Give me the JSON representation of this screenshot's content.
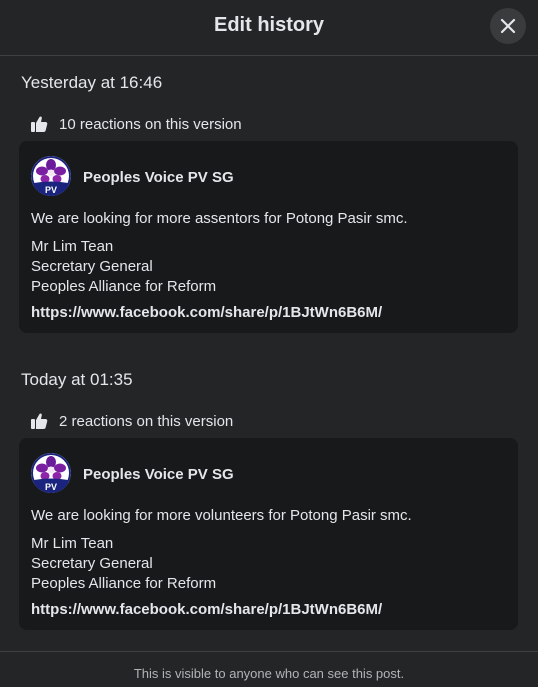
{
  "dialog": {
    "title": "Edit history",
    "close_icon": "close-icon"
  },
  "versions": [
    {
      "timestamp": "Yesterday at 16:46",
      "reactions": "10 reactions on this version",
      "post": {
        "page_name": "Peoples Voice PV SG",
        "avatar_text": "PV",
        "text": "We are looking for more assentors for Potong Pasir smc.",
        "signature": [
          "Mr Lim Tean",
          "Secretary General",
          "Peoples Alliance for Reform"
        ],
        "link": "https://www.facebook.com/share/p/1BJtWn6B6M/"
      }
    },
    {
      "timestamp": "Today at 01:35",
      "reactions": "2 reactions on this version",
      "post": {
        "page_name": "Peoples Voice PV SG",
        "avatar_text": "PV",
        "text": "We are looking for more volunteers for Potong Pasir smc.",
        "signature": [
          "Mr Lim Tean",
          "Secretary General",
          "Peoples Alliance for Reform"
        ],
        "link": "https://www.facebook.com/share/p/1BJtWn6B6M/"
      }
    }
  ],
  "footer": {
    "text": "This is visible to anyone who can see this post."
  },
  "colors": {
    "background": "#242526",
    "card": "#18191a",
    "text": "#e4e6eb",
    "secondary_text": "#b0b3b8",
    "logo_purple": "#6a1b9a",
    "logo_navy": "#1a237e"
  }
}
